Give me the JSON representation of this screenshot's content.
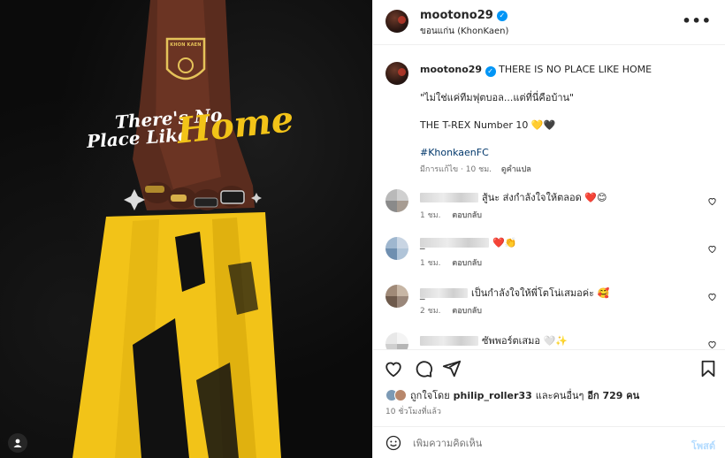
{
  "media": {
    "crest_text": "KHON KAEN",
    "title_line1": "There's No",
    "title_line2": "Place Like",
    "title_line3": "Home",
    "colors": {
      "background": "#0b0b0b",
      "jersey_yellow": "#f2c318",
      "accent_white": "#ffffff"
    },
    "tag_icon": "user-tag-icon"
  },
  "header": {
    "username": "mootono29",
    "location": "ขอนแก่น (KhonKaen)",
    "more_icon": "more-options-icon",
    "more_label": "•••"
  },
  "caption": {
    "username": "mootono29",
    "line1": "THERE IS NO PLACE LIKE HOME",
    "line2": "\"ไม่ใช่แค่ทีมฟุตบอล...แต่ที่นี่คือบ้าน\"",
    "line3": "THE T-REX Number 10 💛🖤",
    "hashtag": "#KhonkaenFC",
    "meta": "มีการแก้ไข · 10 ชม.",
    "translate": "ดูคำแปล"
  },
  "comments": [
    {
      "text": "สู้นะ ส่งกำลังใจให้ตลอด ❤️😊",
      "time": "1 ชม.",
      "reply": "ตอบกลับ",
      "username_visible": ""
    },
    {
      "text": "❤️👏",
      "time": "1 ชม.",
      "reply": "ตอบกลับ",
      "username_visible": "_"
    },
    {
      "text": "เป็นกำลังใจให้พี่โตโน่เสมอค่ะ 🥰",
      "time": "2 ชม.",
      "reply": "ตอบกลับ",
      "username_visible": "_"
    },
    {
      "text": "ซัพพอร์ตเสมอ 🤍✨",
      "time": "",
      "reply": "",
      "username_visible": ""
    }
  ],
  "actions": {
    "like_icon": "heart-icon",
    "comment_icon": "comment-icon",
    "share_icon": "share-icon",
    "save_icon": "bookmark-icon"
  },
  "likes": {
    "prefix": "ถูกใจโดย",
    "user": "philip_roller33",
    "middle": "และคนอื่นๆ",
    "count": "อีก 729 คน"
  },
  "timestamp": "10 ชั่วโมงที่แล้ว",
  "add_comment": {
    "placeholder": "เพิ่มความคิดเห็น",
    "post_label": "โพสต์",
    "emoji_icon": "emoji-icon"
  },
  "colors": {
    "link": "#00376b",
    "verified": "#0095f6",
    "post_disabled": "#b3dbff",
    "secondary": "#737373",
    "heart_red": "#ed4956"
  }
}
